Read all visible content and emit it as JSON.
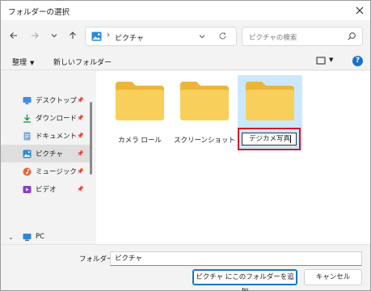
{
  "window": {
    "title": "フォルダーの選択"
  },
  "nav": {
    "address_path": "ピクチャ",
    "search_placeholder": "ピクチャの検索"
  },
  "commands": {
    "organize": "整理",
    "new_folder": "新しいフォルダー"
  },
  "sidebar": {
    "items": [
      {
        "label": "デスクトップ",
        "icon": "desktop-icon",
        "pinned": true
      },
      {
        "label": "ダウンロード",
        "icon": "download-icon",
        "pinned": true
      },
      {
        "label": "ドキュメント",
        "icon": "documents-icon",
        "pinned": true
      },
      {
        "label": "ピクチャ",
        "icon": "pictures-icon",
        "pinned": true,
        "selected": true
      },
      {
        "label": "ミュージック",
        "icon": "music-icon",
        "pinned": true
      },
      {
        "label": "ビデオ",
        "icon": "videos-icon",
        "pinned": true
      }
    ],
    "pc_label": "PC"
  },
  "content": {
    "folders": [
      {
        "label": "カメラ ロール"
      },
      {
        "label": "スクリーンショット"
      },
      {
        "label": "",
        "rename_value": "デジカメ写真",
        "selected": true,
        "renaming": true
      }
    ]
  },
  "footer": {
    "folder_label": "フォルダー:",
    "folder_value": "ピクチャ",
    "primary_button": "ピクチャ にこのフォルダーを追加",
    "cancel_button": "キャンセル"
  },
  "colors": {
    "accent": "#1a73c9",
    "selection": "#cce8ff",
    "highlight_border": "#d01a2a",
    "folder_front": "#f8cf5a",
    "folder_back": "#eab53a"
  }
}
